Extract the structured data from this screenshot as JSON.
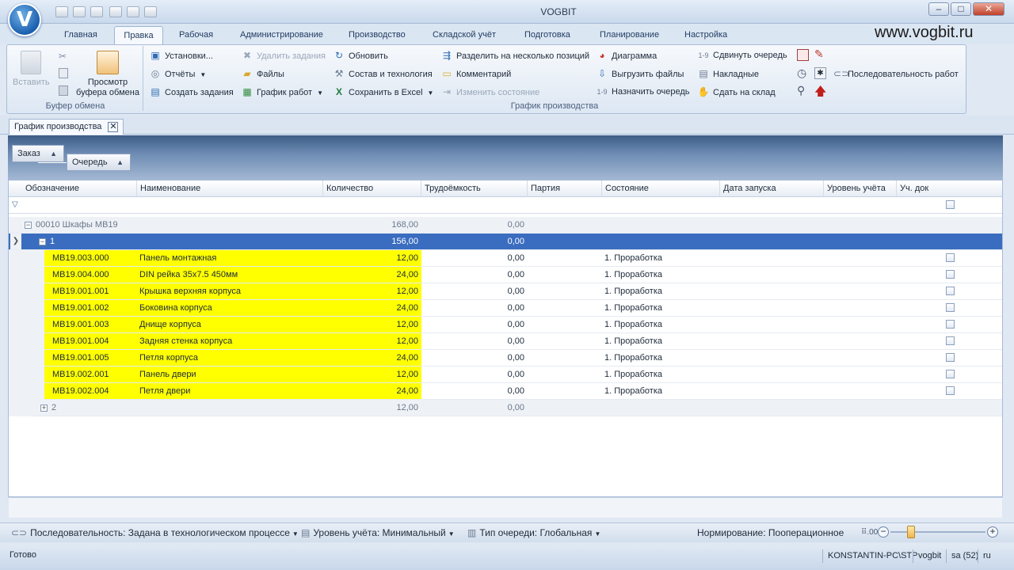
{
  "window": {
    "title": "VOGBIT",
    "brand": "www.vogbit.ru"
  },
  "ribbon_tabs": [
    "Главная",
    "Правка",
    "Рабочая",
    "Администрирование",
    "Производство",
    "Складской учёт",
    "Подготовка",
    "Планирование",
    "Настройка"
  ],
  "clipboard": {
    "paste": "Вставить",
    "preview_line1": "Просмотр",
    "preview_line2": "буфера обмена",
    "group_label": "Буфер обмена"
  },
  "production": {
    "col1": [
      "Установки...",
      "Отчёты",
      "Создать задания"
    ],
    "col2": [
      "Удалить задания",
      "Файлы",
      "График работ"
    ],
    "col3": [
      "Обновить",
      "Состав и технология",
      "Сохранить в Excel"
    ],
    "col4": [
      "Разделить на несколько позиций",
      "Комментарий",
      "Изменить состояние"
    ],
    "col5": [
      "Диаграмма",
      "Выгрузить файлы",
      "Назначить очередь"
    ],
    "col6": [
      "Сдвинуть очередь",
      "Накладные",
      "Сдать на склад"
    ],
    "extra": "Последовательность работ",
    "group_label": "График производства"
  },
  "doc_tab": {
    "label": "График производства",
    "close": "✕"
  },
  "grouping": {
    "g1": "Заказ",
    "g2": "Очередь",
    "arrow": "▲"
  },
  "columns": [
    "Обозначение",
    "Наименование",
    "Количество",
    "Трудоёмкость",
    "Партия",
    "Состояние",
    "Дата запуска",
    "Уровень учёта",
    "Уч. док"
  ],
  "group_row": {
    "label": "00010 Шкафы МВ19",
    "qty": "168,00",
    "labor": "0,00",
    "toggle": "−"
  },
  "sub1": {
    "label": "1",
    "qty": "156,00",
    "labor": "0,00",
    "toggle": "−"
  },
  "rows": [
    {
      "code": "МВ19.003.000",
      "name": "Панель монтажная",
      "qty": "12,00",
      "labor": "0,00",
      "state": "1. Проработка"
    },
    {
      "code": "МВ19.004.000",
      "name": "DIN рейка 35х7.5 450мм",
      "qty": "24,00",
      "labor": "0,00",
      "state": "1. Проработка"
    },
    {
      "code": "МВ19.001.001",
      "name": "Крышка верхняя корпуса",
      "qty": "12,00",
      "labor": "0,00",
      "state": "1. Проработка"
    },
    {
      "code": "МВ19.001.002",
      "name": "Боковина корпуса",
      "qty": "24,00",
      "labor": "0,00",
      "state": "1. Проработка"
    },
    {
      "code": "МВ19.001.003",
      "name": "Днище корпуса",
      "qty": "12,00",
      "labor": "0,00",
      "state": "1. Проработка"
    },
    {
      "code": "МВ19.001.004",
      "name": "Задняя стенка корпуса",
      "qty": "12,00",
      "labor": "0,00",
      "state": "1. Проработка"
    },
    {
      "code": "МВ19.001.005",
      "name": "Петля корпуса",
      "qty": "24,00",
      "labor": "0,00",
      "state": "1. Проработка"
    },
    {
      "code": "МВ19.002.001",
      "name": "Панель двери",
      "qty": "12,00",
      "labor": "0,00",
      "state": "1. Проработка"
    },
    {
      "code": "МВ19.002.004",
      "name": "Петля двери",
      "qty": "24,00",
      "labor": "0,00",
      "state": "1. Проработка"
    }
  ],
  "sub2": {
    "label": "2",
    "qty": "12,00",
    "labor": "0,00",
    "toggle": "+"
  },
  "status": {
    "sequence": "Последовательность: Задана в технологическом процессе",
    "level": "Уровень учёта: Минимальный",
    "queue": "Тип очереди: Глобальная",
    "norm": "Нормирование: Пооперационное",
    "ready": "Готово",
    "host": "KONSTANTIN-PC\\STP",
    "db": "vogbit",
    "user": "sa (52)",
    "lang": "ru"
  },
  "colors": {
    "highlight": "#ffff00",
    "selection": "#3a6dbf"
  }
}
